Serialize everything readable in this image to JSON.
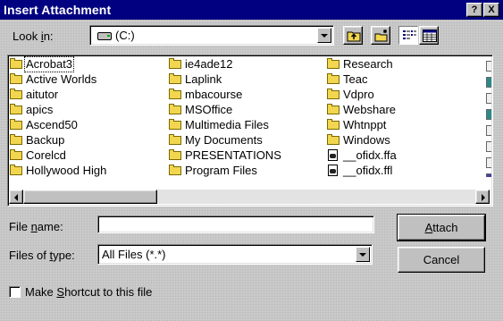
{
  "window": {
    "title": "Insert Attachment",
    "help_button": "?",
    "close_button": "X"
  },
  "look_in": {
    "label_pre": "Look ",
    "label_key": "i",
    "label_post": "n:",
    "value": "(C:)",
    "icon": "drive-icon"
  },
  "toolbar": {
    "up_folder_icon": "up-one-level-icon",
    "new_folder_icon": "create-new-folder-icon",
    "list_view_icon": "list-view-icon",
    "details_view_icon": "details-view-icon"
  },
  "files": {
    "columns": [
      [
        {
          "name": "Acrobat3",
          "type": "folder",
          "selected": true
        },
        {
          "name": "Active Worlds",
          "type": "folder"
        },
        {
          "name": "aitutor",
          "type": "folder"
        },
        {
          "name": "apics",
          "type": "folder"
        },
        {
          "name": "Ascend50",
          "type": "folder"
        },
        {
          "name": "Backup",
          "type": "folder"
        },
        {
          "name": "Corelcd",
          "type": "folder"
        },
        {
          "name": "Hollywood High",
          "type": "folder"
        }
      ],
      [
        {
          "name": "ie4ade12",
          "type": "folder"
        },
        {
          "name": "Laplink",
          "type": "folder"
        },
        {
          "name": "mbacourse",
          "type": "folder"
        },
        {
          "name": "MSOffice",
          "type": "folder"
        },
        {
          "name": "Multimedia Files",
          "type": "folder"
        },
        {
          "name": "My Documents",
          "type": "folder"
        },
        {
          "name": "PRESENTATIONS",
          "type": "folder"
        },
        {
          "name": "Program Files",
          "type": "folder"
        }
      ],
      [
        {
          "name": "Research",
          "type": "folder"
        },
        {
          "name": "Teac",
          "type": "folder"
        },
        {
          "name": "Vdpro",
          "type": "folder"
        },
        {
          "name": "Webshare",
          "type": "folder"
        },
        {
          "name": "Whtnppt",
          "type": "folder"
        },
        {
          "name": "Windows",
          "type": "folder"
        },
        {
          "name": "__ofidx.ffa",
          "type": "file"
        },
        {
          "name": "__ofidx.ffl",
          "type": "file"
        }
      ]
    ]
  },
  "file_name": {
    "label_pre": "File ",
    "label_key": "n",
    "label_post": "ame:",
    "value": ""
  },
  "file_type": {
    "label_pre": "Files of ",
    "label_key": "t",
    "label_post": "ype:",
    "value": "All Files (*.*)"
  },
  "buttons": {
    "attach_key": "A",
    "attach_rest": "ttach",
    "cancel": "Cancel"
  },
  "shortcut": {
    "label_pre": "Make ",
    "label_key": "S",
    "label_post": "hortcut to this file",
    "checked": false
  }
}
